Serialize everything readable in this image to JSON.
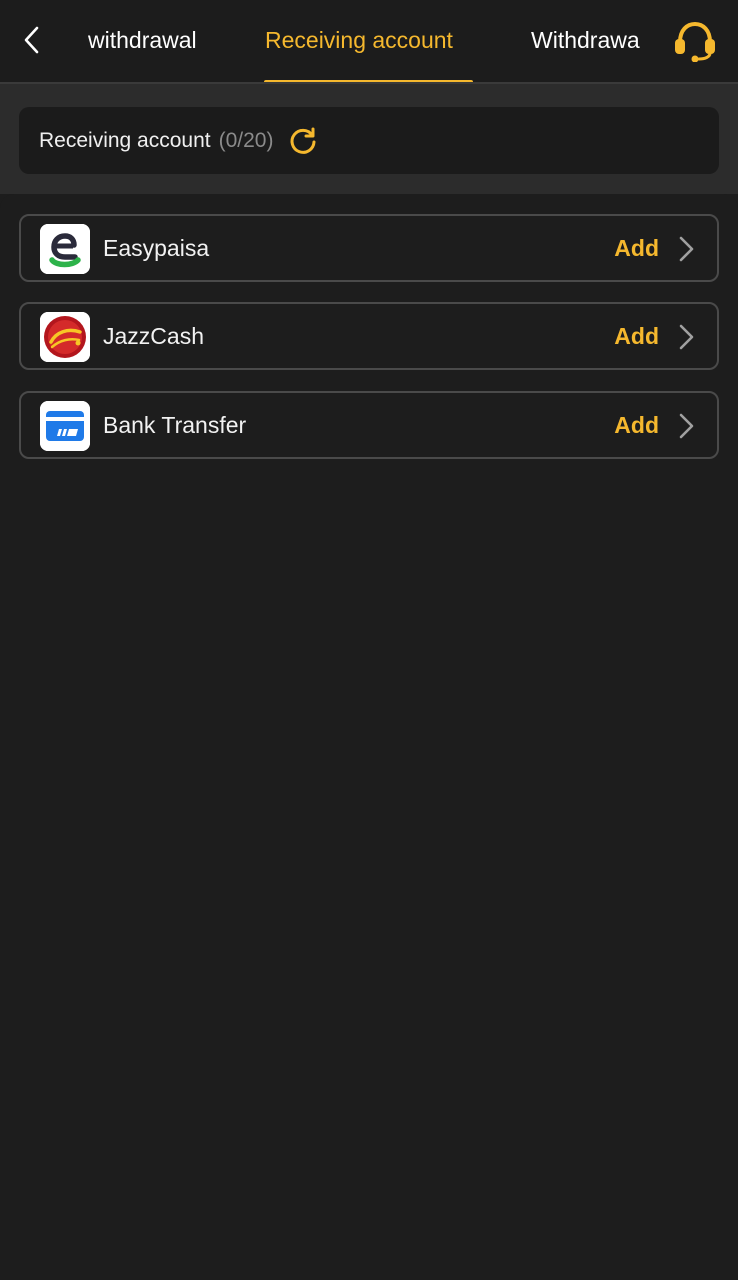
{
  "header": {
    "tabs": [
      {
        "label": "withdrawal",
        "active": false
      },
      {
        "label": "Receiving account",
        "active": true
      },
      {
        "label": "Withdrawa",
        "active": false
      }
    ],
    "back_icon": "chevron-left-icon",
    "support_icon": "headset-icon"
  },
  "summary": {
    "label": "Receiving account",
    "count": "(0/20)",
    "refresh_icon": "refresh-icon"
  },
  "methods": [
    {
      "name": "Easypaisa",
      "action": "Add",
      "icon": "easypaisa-logo-icon"
    },
    {
      "name": "JazzCash",
      "action": "Add",
      "icon": "jazzcash-logo-icon"
    },
    {
      "name": "Bank Transfer",
      "action": "Add",
      "icon": "bank-card-icon"
    }
  ],
  "colors": {
    "accent": "#f5b82e",
    "background": "#1d1d1d",
    "header": "#1c1c1c",
    "band": "#2c2c2c"
  }
}
